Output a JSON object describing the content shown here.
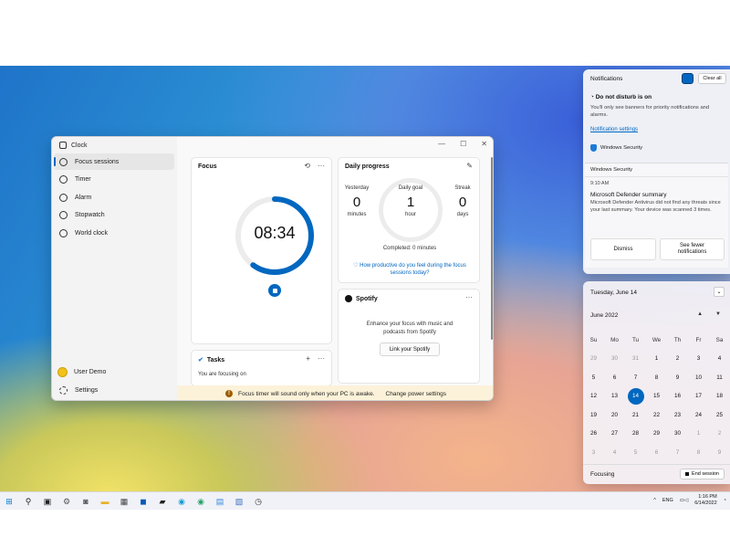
{
  "window": {
    "title": "Clock",
    "controls": [
      "—",
      "☐",
      "✕"
    ],
    "nav": [
      {
        "label": "Focus sessions",
        "icon": "focus-icon",
        "active": true
      },
      {
        "label": "Timer",
        "icon": "timer-icon"
      },
      {
        "label": "Alarm",
        "icon": "alarm-icon"
      },
      {
        "label": "Stopwatch",
        "icon": "stopwatch-icon"
      },
      {
        "label": "World clock",
        "icon": "globe-icon"
      }
    ],
    "user": "User Demo",
    "settings": "Settings"
  },
  "focus": {
    "title": "Focus",
    "time": "08:34",
    "progress": 0.6
  },
  "tasks": {
    "title": "Tasks",
    "text": "You are focusing on"
  },
  "daily": {
    "title": "Daily progress",
    "yesterday_label": "Yesterday",
    "yesterday_value": "0",
    "yesterday_unit": "minutes",
    "goal_label": "Daily goal",
    "goal_value": "1",
    "goal_unit": "hour",
    "streak_label": "Streak",
    "streak_value": "0",
    "streak_unit": "days",
    "completed": "Completed: 0 minutes",
    "question": "How productive do you feel during the focus sessions today?"
  },
  "spotify": {
    "title": "Spotify",
    "text": "Enhance your focus with music and podcasts from Spotify",
    "button": "Link your Spotify"
  },
  "banner": {
    "text": "Focus timer will sound only when your PC is awake.",
    "link": "Change power settings"
  },
  "notifications": {
    "title": "Notifications",
    "clear": "Clear all",
    "dnd_title": "Do not disturb is on",
    "dnd_text": "You'll only see banners for priority notifications and alarms.",
    "settings_link": "Notification settings",
    "source": "Windows Security",
    "card_header": "Windows Security",
    "card_time": "9:10 AM",
    "card_title": "Microsoft Defender summary",
    "card_text": "Microsoft Defender Antivirus did not find any threats since your last summary. Your device was scanned 3 times.",
    "dismiss": "Dismiss",
    "see_fewer": "See fewer notifications"
  },
  "calendar": {
    "date": "Tuesday, June 14",
    "month": "June 2022",
    "days_of_week": [
      "Su",
      "Mo",
      "Tu",
      "We",
      "Th",
      "Fr",
      "Sa"
    ],
    "weeks": [
      [
        "29",
        "30",
        "31",
        "1",
        "2",
        "3",
        "4"
      ],
      [
        "5",
        "6",
        "7",
        "8",
        "9",
        "10",
        "11"
      ],
      [
        "12",
        "13",
        "14",
        "15",
        "16",
        "17",
        "18"
      ],
      [
        "19",
        "20",
        "21",
        "22",
        "23",
        "24",
        "25"
      ],
      [
        "26",
        "27",
        "28",
        "29",
        "30",
        "1",
        "2"
      ],
      [
        "3",
        "4",
        "5",
        "6",
        "7",
        "8",
        "9"
      ]
    ],
    "today": "14",
    "focusing": "Focusing",
    "end_session": "End session"
  },
  "taskbar": {
    "language": "ENG",
    "time": "1:16 PM",
    "date": "6/14/2022"
  }
}
